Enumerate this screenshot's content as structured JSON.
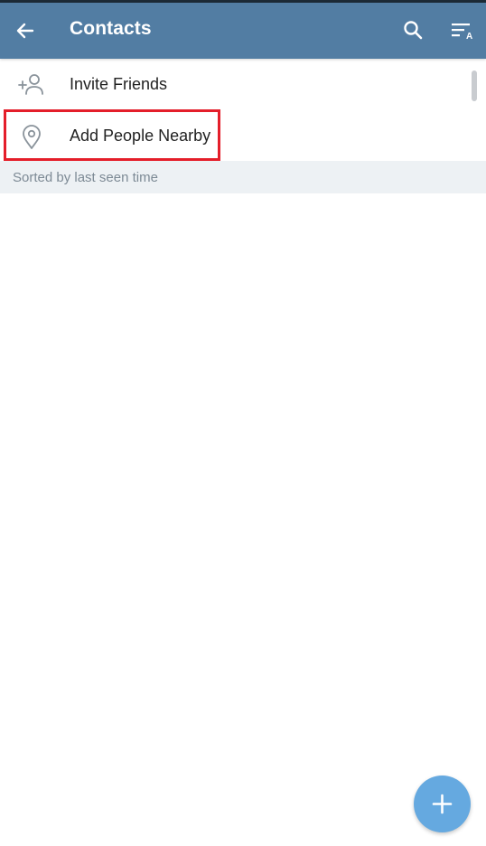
{
  "appbar": {
    "title": "Contacts",
    "back_icon": "arrow-left-icon",
    "search_icon": "search-icon",
    "sort_icon": "sort-alphabetical-icon",
    "background_color": "#527da3"
  },
  "actions": [
    {
      "label": "Invite Friends",
      "icon": "add-user-icon"
    },
    {
      "label": "Add People Nearby",
      "icon": "location-pin-icon",
      "highlighted": true
    }
  ],
  "section_header": {
    "label": "Sorted by last seen time"
  },
  "contacts": [],
  "fab": {
    "icon": "plus-icon",
    "color": "#65a9e0"
  },
  "highlight_color": "#e41e2a"
}
